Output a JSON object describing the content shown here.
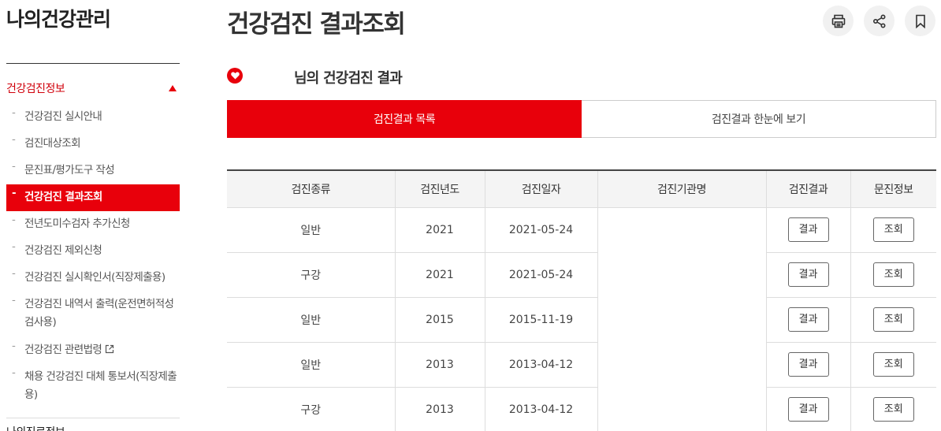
{
  "sidebar": {
    "title": "나의건강관리",
    "section": "건강검진정보",
    "items": [
      {
        "label": "건강검진 실시안내"
      },
      {
        "label": "검진대상조회"
      },
      {
        "label": "문진표/평가도구 작성"
      },
      {
        "label": "건강검진 결과조회"
      },
      {
        "label": "전년도미수검자 추가신청"
      },
      {
        "label": "건강검진 제외신청"
      },
      {
        "label": "건강검진 실시확인서(직장제출용)"
      },
      {
        "label": "건강검진 내역서 출력(운전면허적성검사용)"
      },
      {
        "label": "건강검진 관련법령"
      },
      {
        "label": "채용 건강검진 대체 통보서(직장제출용)"
      }
    ],
    "active_index": 3,
    "next_section": "나의진료정보"
  },
  "header": {
    "title": "건강검진 결과조회",
    "tools": [
      "print-icon",
      "share-icon",
      "bookmark-icon"
    ]
  },
  "main": {
    "subtitle": "님의 건강검진 결과",
    "tabs": [
      {
        "label": "검진결과 목록",
        "active": true
      },
      {
        "label": "검진결과 한눈에 보기",
        "active": false
      }
    ],
    "table": {
      "headers": [
        "검진종류",
        "검진년도",
        "검진일자",
        "검진기관명",
        "검진결과",
        "문진정보"
      ],
      "result_button": "결과",
      "survey_button": "조회",
      "rows": [
        {
          "type": "일반",
          "year": "2021",
          "date": "2021-05-24"
        },
        {
          "type": "구강",
          "year": "2021",
          "date": "2021-05-24"
        },
        {
          "type": "일반",
          "year": "2015",
          "date": "2015-11-19"
        },
        {
          "type": "일반",
          "year": "2013",
          "date": "2013-04-12"
        },
        {
          "type": "구강",
          "year": "2013",
          "date": "2013-04-12"
        }
      ]
    }
  },
  "colors": {
    "accent": "#e8000b",
    "header_bg": "#f4f4f4"
  }
}
